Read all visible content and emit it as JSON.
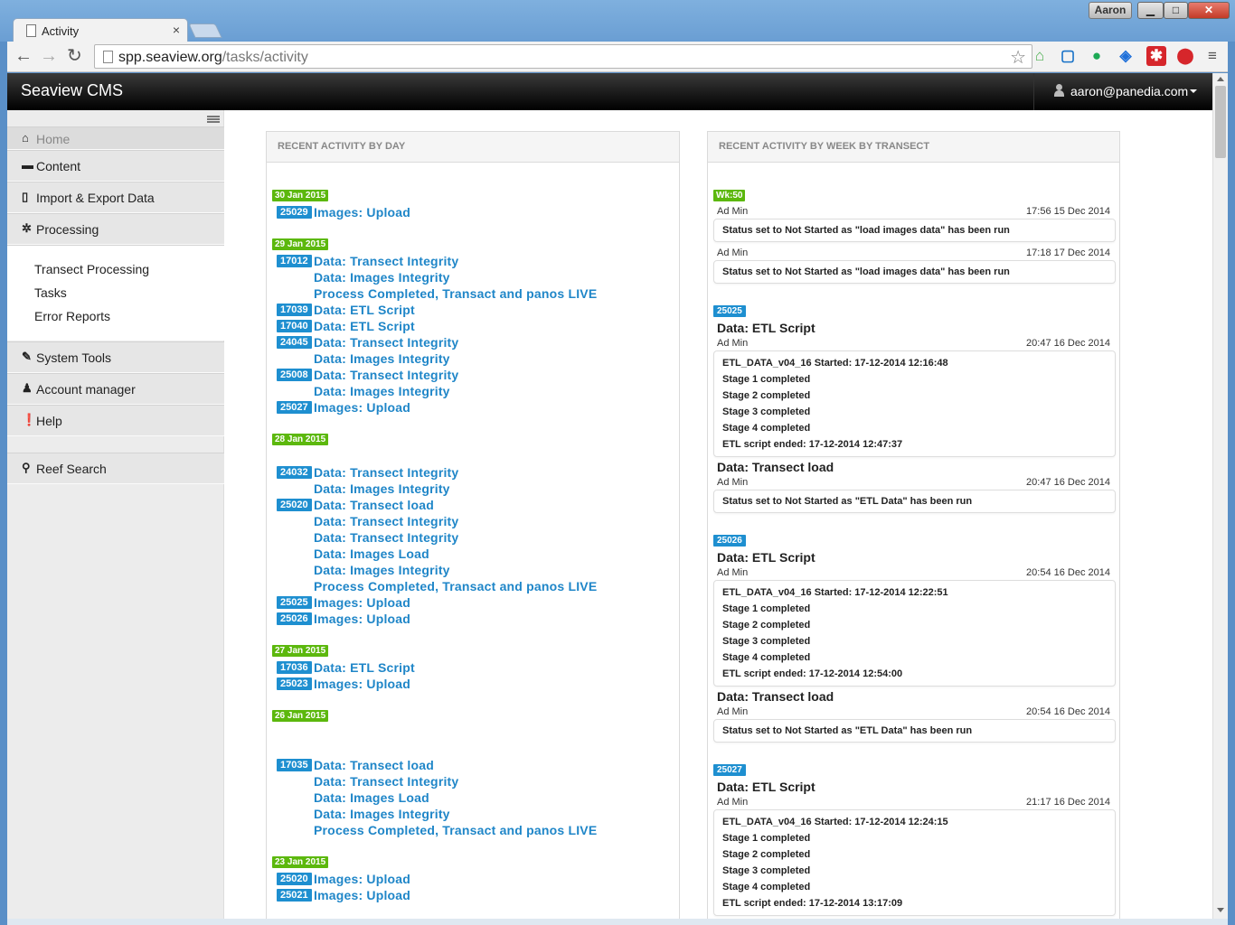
{
  "browser": {
    "tab_title": "Activity",
    "tab_close": "×",
    "user_badge": "Aaron",
    "min": "▁",
    "max": "□",
    "close": "✕",
    "url_host": "spp.seaview.org",
    "url_path": "/tasks/activity",
    "back": "←",
    "forward": "→",
    "reload": "↻",
    "star": "☆",
    "menu": "≡"
  },
  "app": {
    "brand": "Seaview CMS",
    "user_email": "aaron@panedia.com"
  },
  "sidebar": {
    "home": "Home",
    "content": "Content",
    "import_export": "Import & Export Data",
    "processing": "Processing",
    "sub": [
      "Transect Processing",
      "Tasks",
      "Error Reports"
    ],
    "system_tools": "System Tools",
    "account_manager": "Account manager",
    "help": "Help",
    "reef_search": "Reef Search"
  },
  "left_panel": {
    "title": "RECENT ACTIVITY BY DAY",
    "dates": [
      "30 Jan 2015",
      "29 Jan 2015",
      "28 Jan 2015",
      "27 Jan 2015",
      "26 Jan 2015",
      "23 Jan 2015"
    ],
    "ids": [
      "25029",
      "17012",
      "17039",
      "17040",
      "24045",
      "25008",
      "25027",
      "24032",
      "25020",
      "25025",
      "25026",
      "17036",
      "25023",
      "17035",
      "25020",
      "25021"
    ],
    "items": [
      "Images: Upload",
      "Data: Transect Integrity",
      "Data: Images Integrity",
      "Process Completed, Transact and panos LIVE",
      "Data: ETL Script",
      "Data: ETL Script",
      "Data: Transect Integrity",
      "Data: Images Integrity",
      "Data: Transect Integrity",
      "Data: Images Integrity",
      "Images: Upload",
      "Data: Transect Integrity",
      "Data: Images Integrity",
      "Data: Transect load",
      "Data: Transect Integrity",
      "Data: Transect Integrity",
      "Data: Images Load",
      "Data: Images Integrity",
      "Process Completed, Transact and panos LIVE",
      "Images: Upload",
      "Images: Upload",
      "Data: ETL Script",
      "Images: Upload",
      "Data: Transect load",
      "Data: Transect Integrity",
      "Data: Images Load",
      "Data: Images Integrity",
      "Process Completed, Transact and panos LIVE",
      "Images: Upload",
      "Images: Upload"
    ]
  },
  "right_panel": {
    "title": "RECENT ACTIVITY BY WEEK BY TRANSECT",
    "badges": [
      "Wk:50",
      "25025",
      "25026",
      "25027"
    ],
    "user": "Ad Min",
    "times": [
      "17:56 15 Dec 2014",
      "17:18 17 Dec 2014",
      "20:47 16 Dec 2014",
      "20:47 16 Dec 2014",
      "20:54 16 Dec 2014",
      "20:54 16 Dec 2014",
      "21:17 16 Dec 2014"
    ],
    "status_load_images": "Status set to Not Started as \"load images data\" has been run",
    "status_etl": "Status set to Not Started as \"ETL Data\" has been run",
    "etl_title": "Data: ETL Script",
    "transect_load_title": "Data: Transect load",
    "etl_logs": [
      [
        "ETL_DATA_v04_16 Started: 17-12-2014 12:16:48",
        "Stage 1 completed",
        "Stage 2 completed",
        "Stage 3 completed",
        "Stage 4 completed",
        "ETL script ended: 17-12-2014 12:47:37"
      ],
      [
        "ETL_DATA_v04_16 Started: 17-12-2014 12:22:51",
        "Stage 1 completed",
        "Stage 2 completed",
        "Stage 3 completed",
        "Stage 4 completed",
        "ETL script ended: 17-12-2014 12:54:00"
      ],
      [
        "ETL_DATA_v04_16 Started: 17-12-2014 12:24:15",
        "Stage 1 completed",
        "Stage 2 completed",
        "Stage 3 completed",
        "Stage 4 completed",
        "ETL script ended: 17-12-2014 13:17:09"
      ]
    ]
  },
  "colors": {
    "date_badge": "#5cb80d",
    "id_badge": "#1e8fd0",
    "link": "#1f86c8",
    "navbar": "#000000"
  },
  "icons": {
    "home": "home-icon",
    "content": "folder-icon",
    "import": "file-icon",
    "processing": "gear-icon",
    "tools": "wrench-icon",
    "account": "user-icon",
    "help": "exclamation-icon",
    "search": "search-icon"
  }
}
